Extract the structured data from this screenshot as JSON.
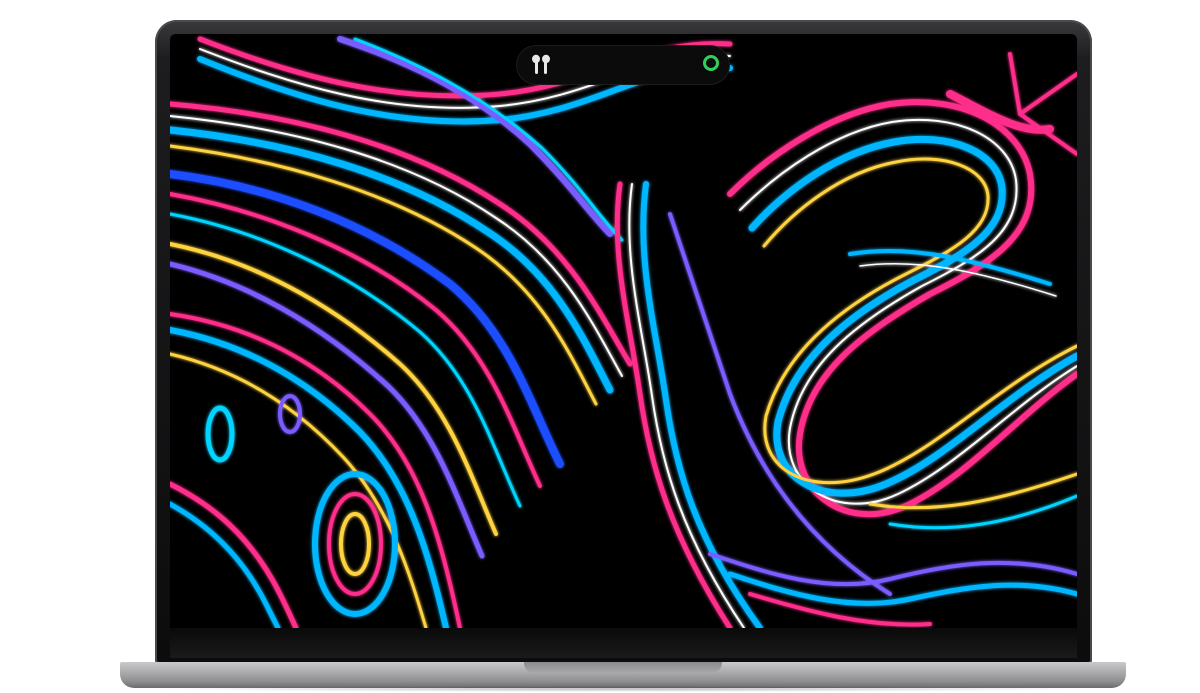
{
  "device": {
    "model": "laptop",
    "finish": "space-gray",
    "frame_color": "#1d1d1f",
    "base_color": "#aeaeb1"
  },
  "screen": {
    "wallpaper": "abstract-liquid-swirls",
    "wallpaper_colors": [
      "#000000",
      "#ff2d8a",
      "#00b7ff",
      "#ffd23f",
      "#7a5cff",
      "#ffffff"
    ]
  },
  "island": {
    "left_icon": "airpods-icon",
    "right_icon": "progress-ring-icon",
    "ring_color": "#30d158"
  }
}
